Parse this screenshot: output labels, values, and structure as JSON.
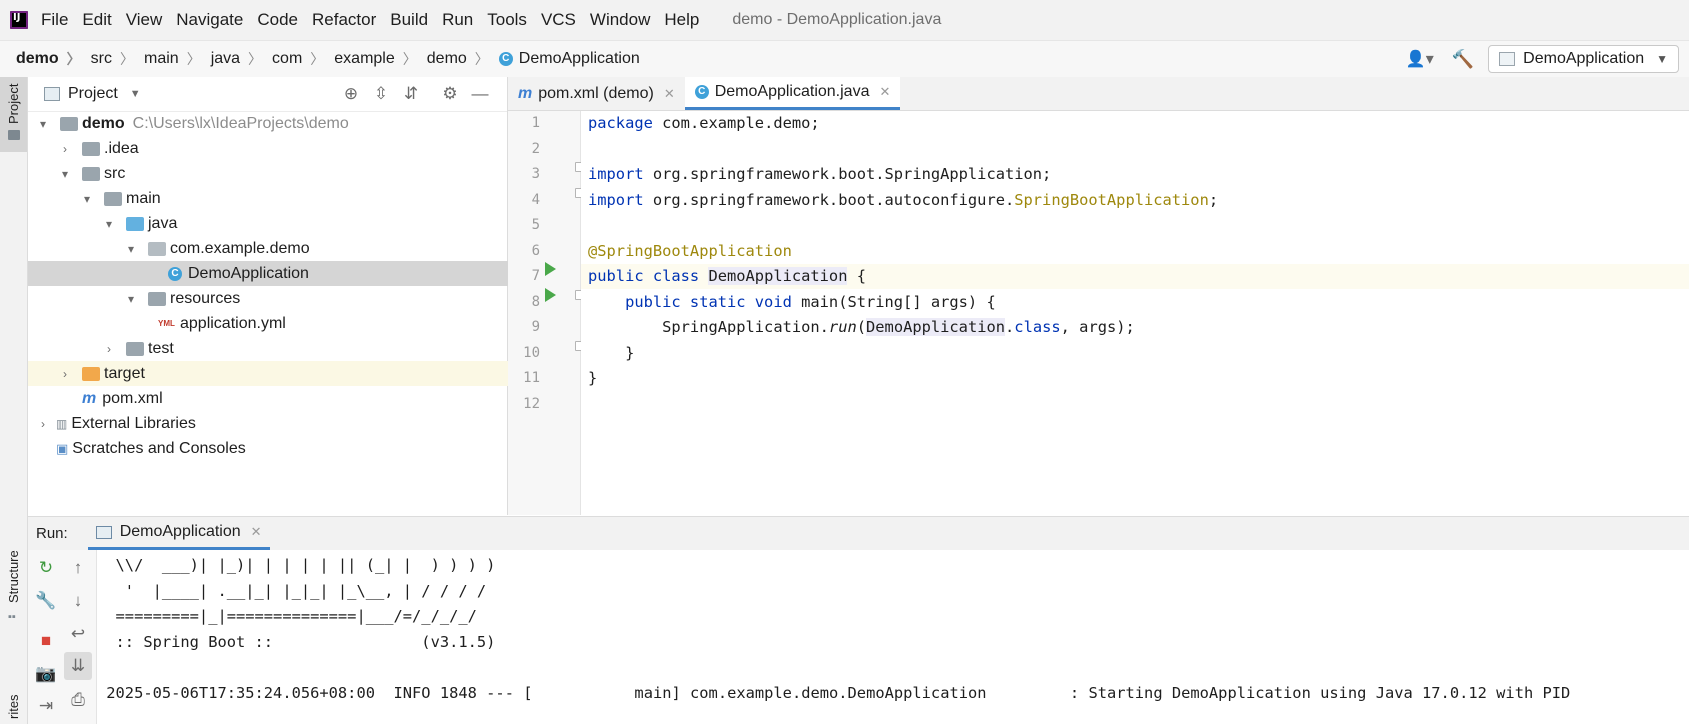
{
  "menubar": {
    "items": [
      "File",
      "Edit",
      "View",
      "Navigate",
      "Code",
      "Refactor",
      "Build",
      "Run",
      "Tools",
      "VCS",
      "Window",
      "Help"
    ],
    "window_title": "demo - DemoApplication.java"
  },
  "breadcrumb": {
    "items": [
      "demo",
      "src",
      "main",
      "java",
      "com",
      "example",
      "demo",
      "DemoApplication"
    ]
  },
  "toolbar": {
    "run_config": "DemoApplication",
    "icons": [
      "user-icon",
      "hammer-icon"
    ]
  },
  "left_strip": {
    "project_tab": "Project",
    "structure_tab": "Structure",
    "favorites_tab": "rites"
  },
  "project_panel": {
    "title": "Project",
    "tree": [
      {
        "label": "demo",
        "path": "C:\\Users\\lx\\IdeaProjects\\demo",
        "depth": 0,
        "arrow": "open",
        "icon": "module-folder"
      },
      {
        "label": ".idea",
        "depth": 1,
        "arrow": "closed",
        "icon": "folder"
      },
      {
        "label": "src",
        "depth": 1,
        "arrow": "open",
        "icon": "folder"
      },
      {
        "label": "main",
        "depth": 2,
        "arrow": "open",
        "icon": "folder"
      },
      {
        "label": "java",
        "depth": 3,
        "arrow": "open",
        "icon": "source-folder"
      },
      {
        "label": "com.example.demo",
        "depth": 4,
        "arrow": "open",
        "icon": "package"
      },
      {
        "label": "DemoApplication",
        "depth": 5,
        "arrow": "none",
        "icon": "class",
        "selected": true
      },
      {
        "label": "resources",
        "depth": 3,
        "arrow": "open",
        "icon": "resources-folder"
      },
      {
        "label": "application.yml",
        "depth": 4,
        "arrow": "none",
        "icon": "yml"
      },
      {
        "label": "test",
        "depth": 2,
        "arrow": "closed",
        "icon": "folder"
      },
      {
        "label": "target",
        "depth": 1,
        "arrow": "closed",
        "icon": "excluded-folder",
        "highlight": true
      },
      {
        "label": "pom.xml",
        "depth": 1,
        "arrow": "none",
        "icon": "maven"
      },
      {
        "label": "External Libraries",
        "depth": 0,
        "arrow": "closed",
        "icon": "libraries"
      },
      {
        "label": "Scratches and Consoles",
        "depth": 0,
        "arrow": "none",
        "icon": "scratches"
      }
    ]
  },
  "editor": {
    "tabs": [
      {
        "label": "pom.xml (demo)",
        "icon": "m"
      },
      {
        "label": "DemoApplication.java",
        "icon": "C",
        "active": true
      }
    ],
    "line_numbers": [
      "1",
      "2",
      "3",
      "4",
      "5",
      "6",
      "7",
      "8",
      "9",
      "10",
      "11",
      "12"
    ],
    "code": {
      "l1_kw": "package",
      "l1_rest": " com.example.demo;",
      "l3_kw": "import",
      "l3_rest": " org.springframework.boot.SpringApplication;",
      "l4_kw": "import",
      "l4_mid": " org.springframework.boot.autoconfigure.",
      "l4_ann": "SpringBootApplication",
      "l4_end": ";",
      "l6_ann": "@SpringBootApplication",
      "l7_kw": "public class ",
      "l7_ident": "DemoApplication",
      "l7_end": " {",
      "l8_kw": "    public static void ",
      "l8_rest": "main(String[] args) {",
      "l9_a": "        SpringApplication.",
      "l9_run": "run",
      "l9_b": "(",
      "l9_ident": "DemoApplication",
      "l9_c": ".",
      "l9_kw": "class",
      "l9_d": ", args);",
      "l10": "    }",
      "l11": "}"
    }
  },
  "run_panel": {
    "label": "Run:",
    "tab": "DemoApplication",
    "console_lines": [
      "  \\\\/  ___)| |_)| | | | | || (_| |  ) ) ) )",
      "   '  |____| .__|_| |_|_| |_\\__, | / / / /",
      "  =========|_|==============|___/=/_/_/_/",
      "  :: Spring Boot ::                (v3.1.5)",
      "",
      " 2025-05-06T17:35:24.056+08:00  INFO 1848 --- [           main] com.example.demo.DemoApplication         : Starting DemoApplication using Java 17.0.12 with PID"
    ]
  }
}
